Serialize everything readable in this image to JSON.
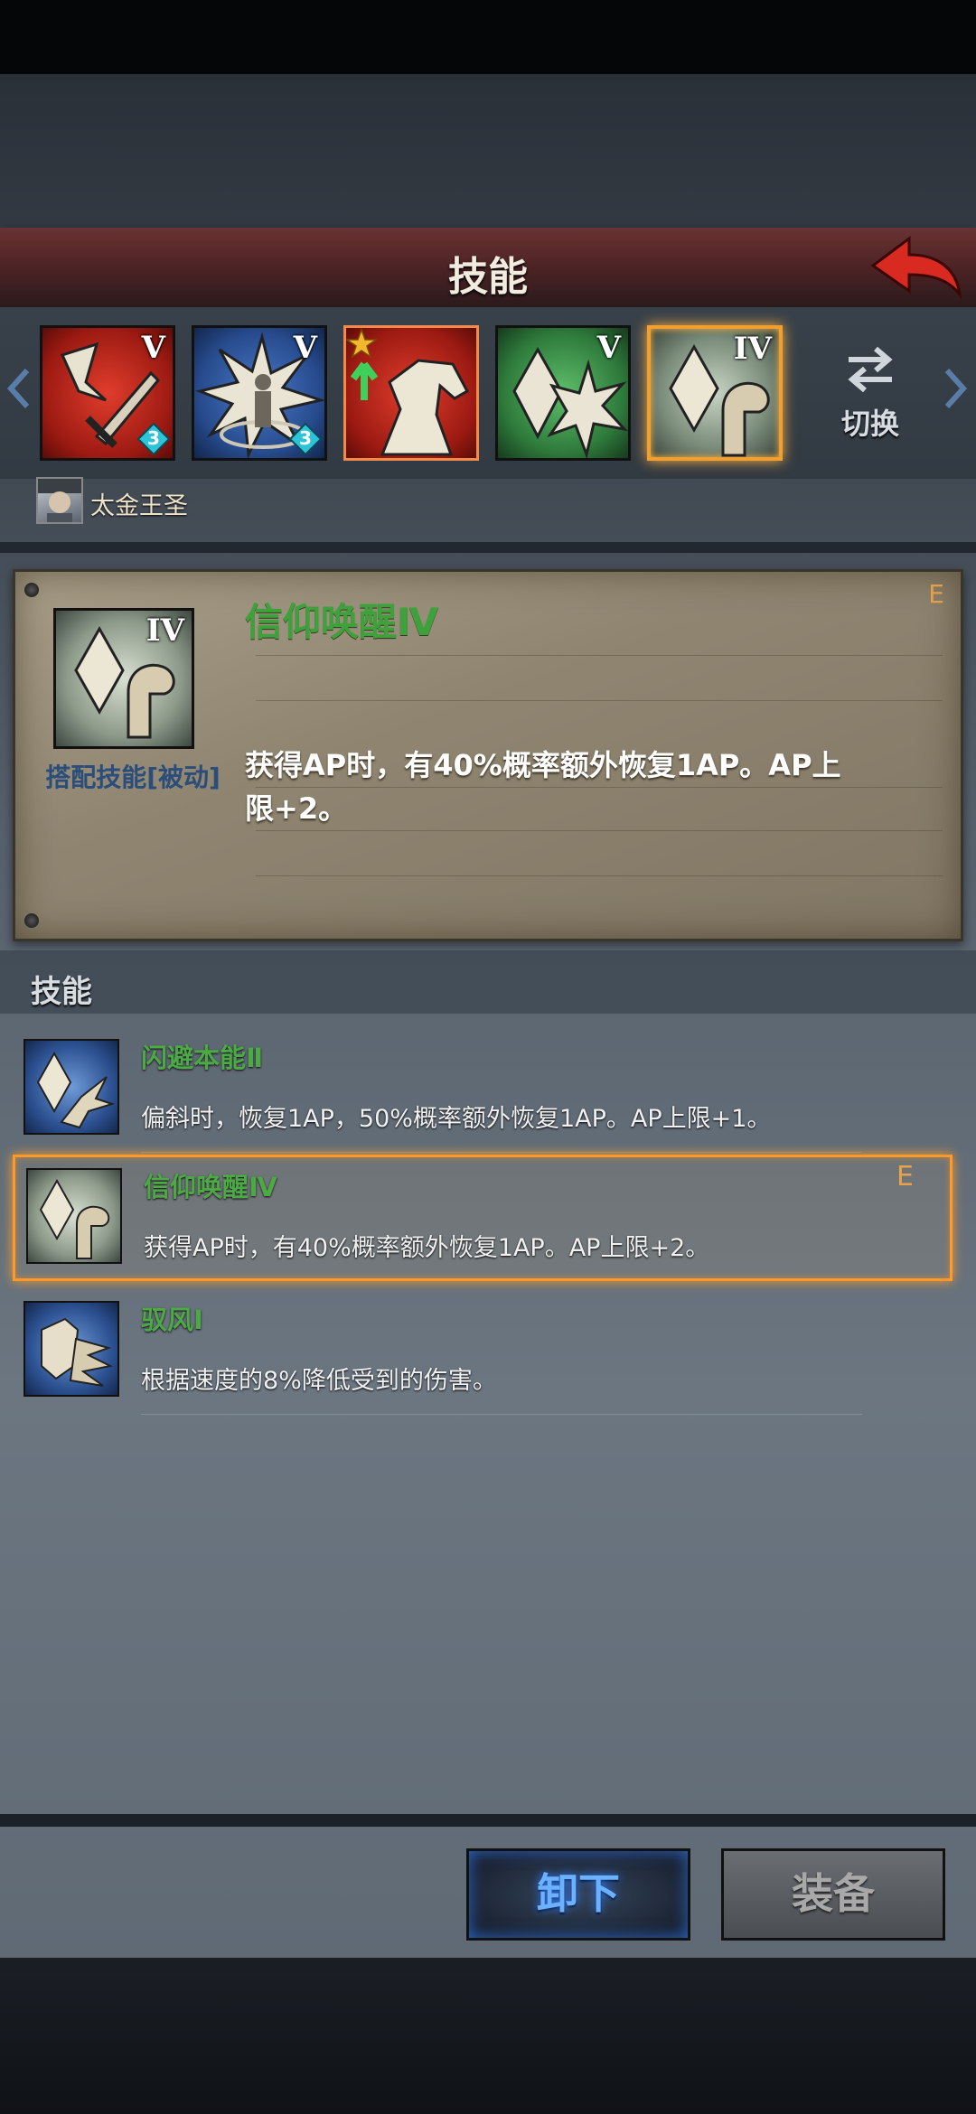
{
  "header": {
    "title": "技能"
  },
  "slots": [
    {
      "rank": "V",
      "badge": "3"
    },
    {
      "rank": "V",
      "badge": "3"
    },
    {
      "rank": ""
    },
    {
      "rank": "V"
    },
    {
      "rank": "IV"
    }
  ],
  "switch_label": "切换",
  "character": {
    "name": "太金王圣"
  },
  "detail": {
    "title": "信仰唤醒Ⅳ",
    "tag": "E",
    "type": "搭配技能[被动]",
    "description": "获得AP时，有40%概率额外恢复1AP。AP上限+2。"
  },
  "skills_section": {
    "label": "技能"
  },
  "skills": [
    {
      "name": "闪避本能Ⅱ",
      "desc": "偏斜时，恢复1AP，50%概率额外恢复1AP。AP上限+1。",
      "tag": ""
    },
    {
      "name": "信仰唤醒Ⅳ",
      "desc": "获得AP时，有40%概率额外恢复1AP。AP上限+2。",
      "tag": "E"
    },
    {
      "name": "驭风Ⅰ",
      "desc": "根据速度的8%降低受到的伤害。",
      "tag": ""
    }
  ],
  "buttons": {
    "unequip": "卸下",
    "equip": "装备"
  },
  "colors": {
    "skill_name": "#4caa45",
    "selection": "#ff9a2a",
    "header_bg": "#4a2224"
  }
}
